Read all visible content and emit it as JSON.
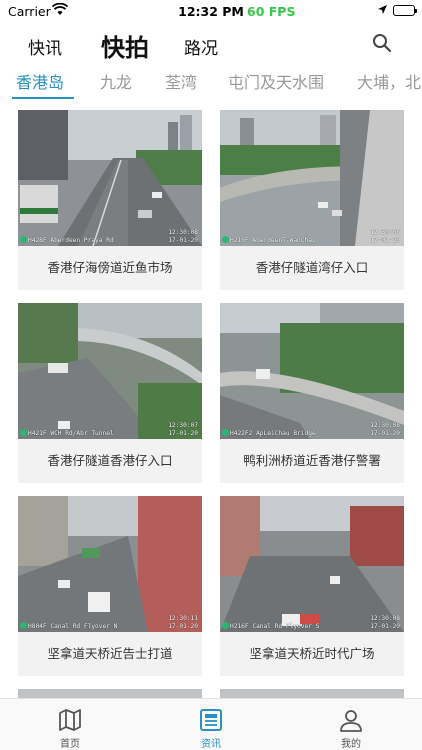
{
  "status": {
    "carrier": "Carrier",
    "time": "12:32 PM",
    "fps": "60 FPS"
  },
  "topnav": {
    "tabs": [
      "快讯",
      "快拍",
      "路况"
    ],
    "active": "快拍"
  },
  "districts": [
    "香港岛",
    "九龙",
    "荃湾",
    "屯门及天水围",
    "大埔，北区"
  ],
  "cameras": [
    {
      "caption": "香港仔海傍道近鱼市场",
      "label": "H428F Aberdeen Praya Rd",
      "time": "12:30:08",
      "date": "17-01-20"
    },
    {
      "caption": "香港仔隧道湾仔入口",
      "label": "H210F AberdeenT-WanChai",
      "time": "12:30:08",
      "date": "17-01-20"
    },
    {
      "caption": "香港仔隧道香港仔入口",
      "label": "H421F WCH Rd/Abr Tunnel",
      "time": "12:30:07",
      "date": "17-01-20"
    },
    {
      "caption": "鸭利洲桥道近香港仔警署",
      "label": "H422F2 ApLeiChau Bridge",
      "time": "12:30:08",
      "date": "17-01-20"
    },
    {
      "caption": "坚拿道天桥近告士打道",
      "label": "H804F Canal Rd Flyover N",
      "time": "12:30:11",
      "date": "17-01-20"
    },
    {
      "caption": "坚拿道天桥近时代广场",
      "label": "H216F Canal Rd Flyover S",
      "time": "12:30:08",
      "date": "17-01-20"
    }
  ],
  "tabbar": {
    "items": [
      {
        "label": "首页",
        "icon": "map-icon"
      },
      {
        "label": "资讯",
        "icon": "news-icon"
      },
      {
        "label": "我的",
        "icon": "profile-icon"
      }
    ]
  },
  "colors": {
    "accent": "#2a8fc1",
    "fps": "#36c748",
    "card_bg": "#f2f2f2"
  }
}
